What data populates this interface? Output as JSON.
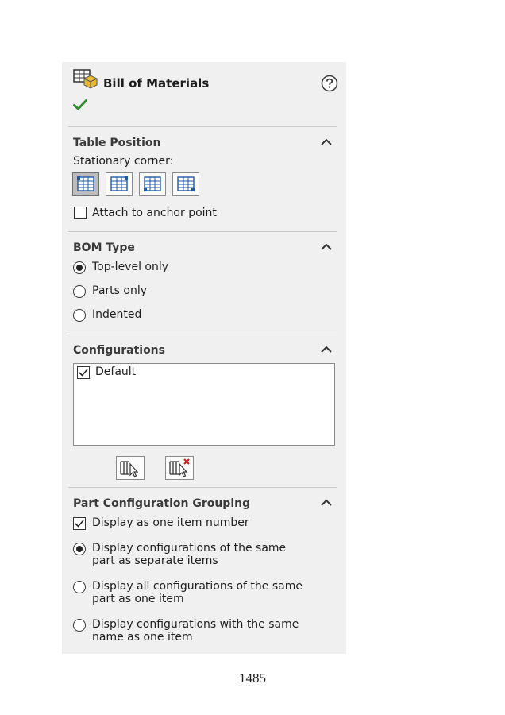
{
  "header": {
    "title": "Bill of Materials",
    "help_icon": "question-circle-icon",
    "ok_icon": "checkmark-icon"
  },
  "table_position": {
    "title": "Table Position",
    "stationary_label": "Stationary corner:",
    "corners": [
      "top-left",
      "top-right",
      "bottom-left",
      "bottom-right"
    ],
    "selected_corner": "top-left",
    "attach_label": "Attach to anchor point",
    "attach_checked": false
  },
  "bom_type": {
    "title": "BOM Type",
    "options": [
      "Top-level only",
      "Parts only",
      "Indented"
    ],
    "selected": "Top-level only"
  },
  "configurations": {
    "title": "Configurations",
    "items": [
      {
        "label": "Default",
        "checked": true
      }
    ],
    "select_button_icon": "select-configurations-icon",
    "clear_button_icon": "clear-configurations-icon"
  },
  "grouping": {
    "title": "Part Configuration Grouping",
    "display_one_item_label": "Display as one item number",
    "display_one_item_checked": true,
    "options": [
      [
        "Display configurations of the same",
        "part as separate items"
      ],
      [
        "Display all configurations of the same",
        "part as one item"
      ],
      [
        "Display configurations with the same",
        "name as one item"
      ]
    ],
    "selected_index": 0
  },
  "page_number": "1485",
  "colors": {
    "accent_check": "#2e8b2e",
    "panel_bg": "#f0f0f0",
    "clear_x": "#d0201a"
  }
}
